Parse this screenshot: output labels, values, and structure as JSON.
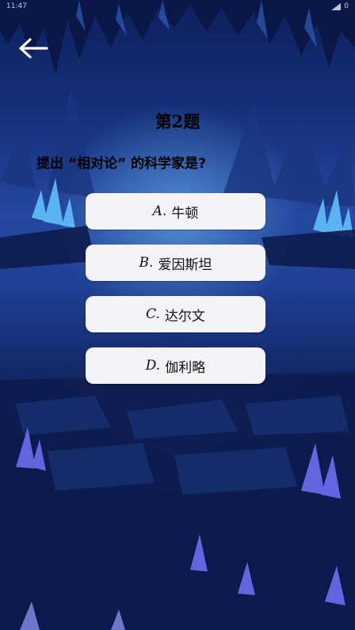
{
  "status_bar": {
    "time": "11:47",
    "battery": "0"
  },
  "header": {
    "title": "第2题"
  },
  "question": {
    "text": "提出 “相对论” 的科学家是?"
  },
  "options": [
    {
      "letter": "A.",
      "text": "牛顿"
    },
    {
      "letter": "B.",
      "text": "爱因斯坦"
    },
    {
      "letter": "C.",
      "text": "达尔文"
    },
    {
      "letter": "D.",
      "text": "伽利略"
    }
  ],
  "icons": {
    "back": "arrow-left-icon"
  },
  "colors": {
    "option_bg": "#f4f4f6",
    "text": "#000000"
  }
}
